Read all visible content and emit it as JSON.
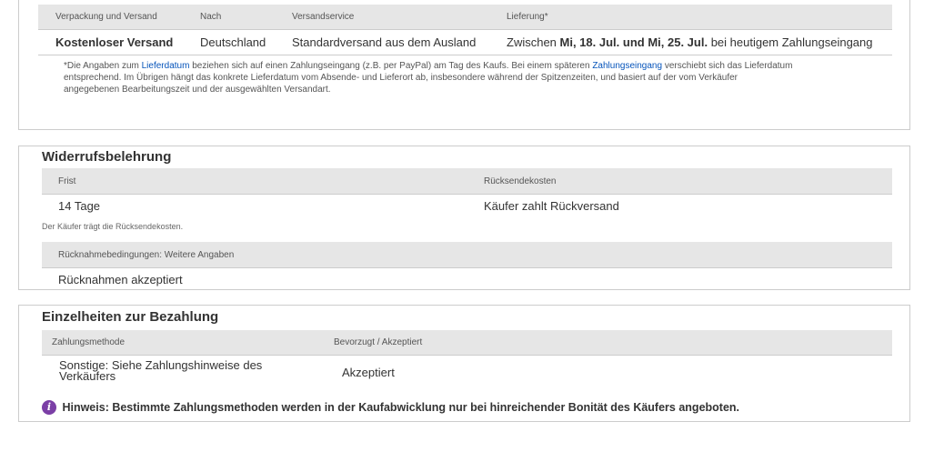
{
  "shipping": {
    "columns": [
      "Verpackung und Versand",
      "Nach",
      "Versandservice",
      "Lieferung*"
    ],
    "row": {
      "cost": "Kostenloser Versand",
      "to": "Deutschland",
      "service": "Standardversand aus dem Ausland",
      "delivery_prefix": "Zwischen ",
      "delivery_dates": "Mi, 18. Jul. und Mi, 25. Jul.",
      "delivery_suffix": " bei heutigem Zahlungseingang"
    },
    "footnote": {
      "p1": "*Die Angaben zum ",
      "link1": "Lieferdatum",
      "p2": " beziehen sich auf einen Zahlungseingang (z.B. per PayPal) am Tag des Kaufs. Bei einem späteren ",
      "link2": "Zahlungseingang",
      "p3": " verschiebt sich das Lieferdatum",
      "line2": "entsprechend. Im Übrigen hängt das konkrete Lieferdatum vom Absende- und Lieferort ab, insbesondere während der Spitzenzeiten, und basiert auf der vom Verkäufer",
      "line3": "angegebenen Bearbeitungszeit und der ausgewählten Versandart."
    }
  },
  "returns": {
    "title": "Widerrufsbelehrung",
    "columns": [
      "Frist",
      "Rücksendekosten"
    ],
    "period": "14 Tage",
    "cost": "Käufer zahlt Rückversand",
    "note": "Der Käufer trägt die Rücksendekosten.",
    "conditions_header": "Rücknahmebedingungen: Weitere Angaben",
    "conditions_value": "Rücknahmen akzeptiert"
  },
  "payment": {
    "title": "Einzelheiten zur Bezahlung",
    "columns": [
      "Zahlungsmethode",
      "Bevorzugt / Akzeptiert"
    ],
    "method_line1": "Sonstige: Siehe Zahlungshinweise des",
    "method_line2": "Verkäufers",
    "status": "Akzeptiert",
    "info_icon": "i",
    "hint": "Hinweis: Bestimmte Zahlungsmethoden werden in der Kaufabwicklung nur bei hinreichender Bonität des Käufers angeboten."
  },
  "colors": {
    "link": "#0654ba",
    "info_icon": "#7b3fa6",
    "header_bg": "#e6e6e6",
    "border": "#cccccc"
  }
}
